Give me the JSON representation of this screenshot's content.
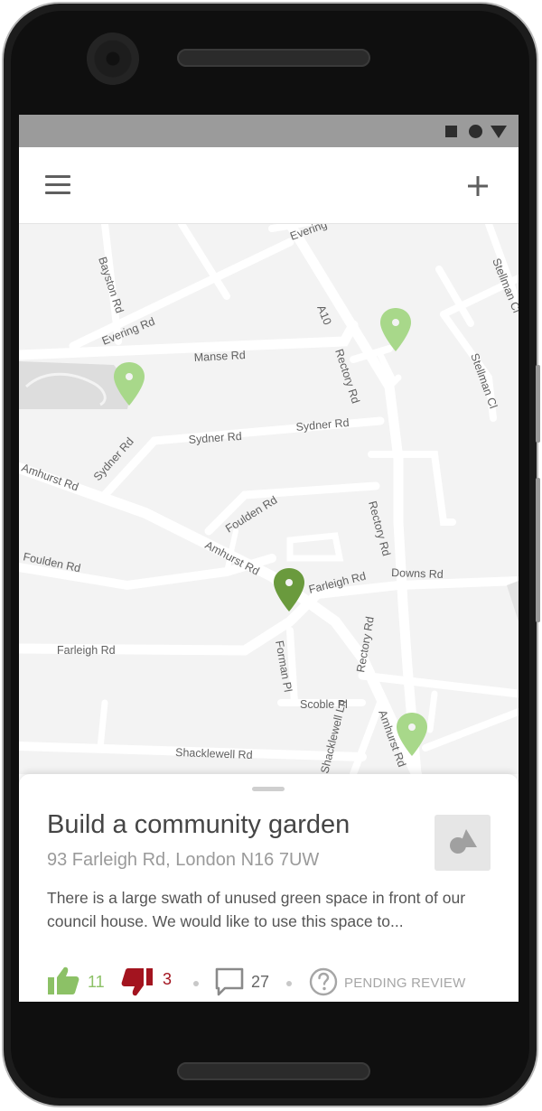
{
  "colors": {
    "pin_active": "#6a9a3d",
    "pin_inactive": "#a8d88a",
    "upvote": "#8cc166",
    "downvote": "#a3141f"
  },
  "appbar": {
    "menu_icon": "hamburger-menu-icon",
    "add_icon": "plus-icon"
  },
  "map": {
    "streets": {
      "evering_top": "Evering",
      "bayston": "Bayston Rd",
      "stellman_top": "Stellman Cl",
      "evering_rd": "Evering Rd",
      "a10": "A10",
      "rectory_top": "Rectory Rd",
      "manse": "Manse Rd",
      "stellman_cl": "Stellman Cl",
      "sydner_right": "Sydner Rd",
      "sydner_mid": "Sydner Rd",
      "sydner_left": "Sydner Rd",
      "amhurst_left": "Amhurst Rd",
      "foulden_mid": "Foulden Rd",
      "rectory_mid": "Rectory Rd",
      "foulden_left": "Foulden Rd",
      "amhurst_mid": "Amhurst Rd",
      "farleigh_small": "Farleigh Rd",
      "downs": "Downs Rd",
      "rectory_low": "Rectory Rd",
      "farleigh": "Farleigh Rd",
      "forman": "Forman Pl",
      "scoble": "Scoble Pl",
      "shacklewell_ln": "Shacklewell Ln",
      "amhurst_low": "Amhurst Rd",
      "shacklewell_rd": "Shacklewell Rd"
    }
  },
  "proposal": {
    "title": "Build a community garden",
    "address": "93 Farleigh Rd, London N16 7UW",
    "description": "There is a large swath of unused green space in front of our council house. We would like to use this space to...",
    "upvotes": "11",
    "downvotes": "3",
    "comments": "27",
    "status": "PENDING REVIEW",
    "thumbnail_icon": "image-placeholder-icon"
  }
}
